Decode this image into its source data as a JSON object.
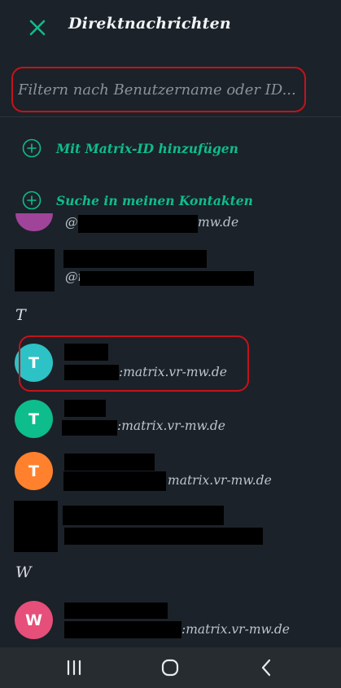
{
  "header": {
    "title": "Direktnachrichten"
  },
  "search": {
    "placeholder": "Filtern nach Benutzername oder ID..."
  },
  "actions": [
    {
      "label": "Mit Matrix-ID hinzufügen",
      "icon": "plus-circle-icon"
    },
    {
      "label": "Suche in meinen Kontakten",
      "icon": "plus-circle-icon"
    }
  ],
  "contacts_top": [
    {
      "id_visible": "@",
      "id_suffix": "mw.de"
    },
    {
      "id_visible": "@r",
      "id_suffix": ""
    }
  ],
  "sections": [
    {
      "letter": "T"
    },
    {
      "letter": "W"
    }
  ],
  "contacts_t": [
    {
      "initial": "T",
      "color": "#2dc2c5",
      "id_suffix": ":matrix.vr-mw.de"
    },
    {
      "initial": "T",
      "color": "#0dbd8b",
      "id_suffix": ":matrix.vr-mw.de"
    },
    {
      "initial": "T",
      "color": "#ff812d",
      "id_suffix": "matrix.vr-mw.de"
    },
    {
      "initial": "",
      "color": "#000000",
      "id_suffix": ""
    }
  ],
  "contacts_w": [
    {
      "initial": "W",
      "color": "#e64f7a",
      "id_suffix": ":matrix.vr-mw.de"
    }
  ],
  "colors": {
    "accent": "#0dbd8b",
    "highlight_outline": "#c4131c",
    "background": "#1c2229"
  },
  "navbar": {
    "icons": [
      "recent-apps-icon",
      "home-icon",
      "back-icon"
    ]
  }
}
